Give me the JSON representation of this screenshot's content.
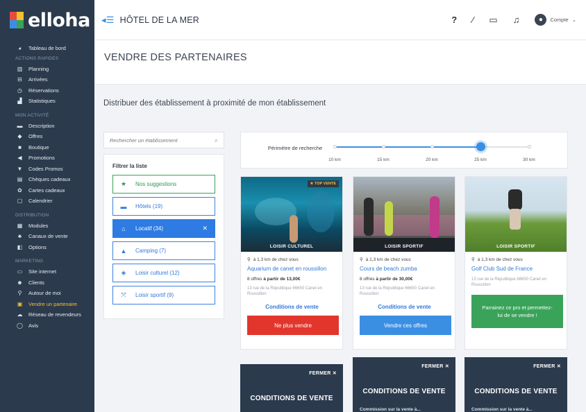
{
  "app": {
    "logo": "elloha",
    "hotel": "HÔTEL DE LA MER",
    "account_label": "Compte"
  },
  "sidebar": {
    "dashboard": "Tableau de bord",
    "sections": [
      {
        "title": "ACTIONS RAPIDES",
        "items": [
          "Planning",
          "Arrivées",
          "Réservations",
          "Statistiques"
        ]
      },
      {
        "title": "MON ACTIVITÉ",
        "items": [
          "Description",
          "Offres",
          "Boutique",
          "Promotions",
          "Codes Promos",
          "Chèques cadeaux",
          "Cartes cadeaux",
          "Calendrier"
        ]
      },
      {
        "title": "DISTRIBUTION",
        "items": [
          "Modules",
          "Canaux de vente",
          "Options"
        ]
      },
      {
        "title": "MARKETING",
        "items": [
          "Site internet",
          "Clients",
          "Autour de moi",
          "Vendre un partenaire",
          "Réseau de revendeurs",
          "Avis"
        ]
      }
    ],
    "active_item": "Vendre un partenaire"
  },
  "page": {
    "title": "VENDRE DES PARTENAIRES",
    "subtitle": "Distribuer des établissement à proximité de mon établissement"
  },
  "filters": {
    "search_placeholder": "Rechercher un établissement",
    "title": "Filtrer la liste",
    "items": [
      {
        "label": "Nos suggestions",
        "icon": "star-icon",
        "style": "green"
      },
      {
        "label": "Hôtels (19)",
        "icon": "bed-icon",
        "style": "outline"
      },
      {
        "label": "Locatif (34)",
        "icon": "house-icon",
        "style": "active"
      },
      {
        "label": "Camping (7)",
        "icon": "tent-icon",
        "style": "outline"
      },
      {
        "label": "Loisir culturel (12)",
        "icon": "cultural-icon",
        "style": "outline"
      },
      {
        "label": "Loisir sportif (9)",
        "icon": "sport-icon",
        "style": "outline"
      }
    ]
  },
  "range": {
    "label": "Périmètre de recherche",
    "ticks": [
      "10 km",
      "15 km",
      "20 km",
      "25 km",
      "30 km"
    ],
    "selected": "25 km"
  },
  "cards": [
    {
      "category": "LOISIR CULTUREL",
      "badge": "TOP VENTE",
      "distance": "à 1,3 km de chez vous",
      "name": "Aquarium de canet en roussillon",
      "offers_prefix": "8 offres ",
      "offers_price": "à partir de 13,00€",
      "address": "13 rue de la République 66650 Canet en Roussillon",
      "conditions": "Conditions de vente",
      "button": "Ne plus vendre"
    },
    {
      "category": "LOISIR SPORTIF",
      "distance": "à 1,3 km de chez vous",
      "name": "Cours de beach zumba",
      "offers_prefix": "8 offres ",
      "offers_price": "à partir de 30,00€",
      "address": "13 rue de la République 66650 Canet en Roussillon",
      "conditions": "Conditions de vente",
      "button": "Vendre ces offres"
    },
    {
      "category": "LOISIR SPORTIF",
      "distance": "à 1,3 km de chez vous",
      "name": "Golf Club Sud de France",
      "address": "13 rue de la République 66650 Canet en Roussillon",
      "button": "Parrainez ce pro et permettez-lui de se vendre !"
    }
  ],
  "conditions_panels": [
    {
      "close": "FERMER ✕",
      "title": "CONDITIONS DE VENTE"
    },
    {
      "close": "FERMER ✕",
      "title": "CONDITIONS DE VENTE",
      "sub": "Commission sur la vente à..."
    },
    {
      "close": "FERMER ✕",
      "title": "CONDITIONS DE VENTE",
      "sub": "Commission sur la vente à..."
    }
  ],
  "colors": {
    "sidebar": "#2c3a4d",
    "accent": "#3b8fe3",
    "active": "#f2c12e",
    "green": "#3aa35a",
    "red": "#e2362c"
  }
}
